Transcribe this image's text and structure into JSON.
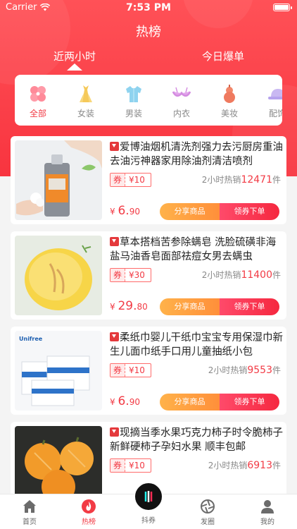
{
  "status": {
    "carrier": "Carrier",
    "time": "7:53 PM"
  },
  "header": {
    "title": "热榜"
  },
  "tabs": [
    {
      "label": "近两小时",
      "active": true
    },
    {
      "label": "今日爆单",
      "active": false
    }
  ],
  "categories": [
    {
      "label": "全部",
      "icon": "all-icon",
      "active": true
    },
    {
      "label": "女装",
      "icon": "dress-icon",
      "active": false
    },
    {
      "label": "男装",
      "icon": "shirt-icon",
      "active": false
    },
    {
      "label": "内衣",
      "icon": "bra-icon",
      "active": false
    },
    {
      "label": "美妆",
      "icon": "gourd-icon",
      "active": false
    },
    {
      "label": "配饰",
      "icon": "hat-icon",
      "active": false
    }
  ],
  "products": [
    {
      "title": "爱博油烟机清洗剂强力去污厨房重油去油污神器家用除油剂清洁喷剂",
      "coupon_tag": "券",
      "coupon_value": "¥10",
      "sold_prefix": "2小时热销",
      "sold_count": "12471",
      "sold_unit": "件",
      "price_symbol": "¥",
      "price_int": "6.",
      "price_dec": "90",
      "share_label": "分享商品",
      "get_label": "领券下单"
    },
    {
      "title": "草本搭档苦参除螨皂 洗脸硫磺非海盐马油香皂面部祛痘女男去螨虫",
      "coupon_tag": "券",
      "coupon_value": "¥30",
      "sold_prefix": "2小时热销",
      "sold_count": "11400",
      "sold_unit": "件",
      "price_symbol": "¥",
      "price_int": "29.",
      "price_dec": "80",
      "share_label": "分享商品",
      "get_label": "领券下单"
    },
    {
      "title": "柔纸巾婴儿干纸巾宝宝专用保湿巾新生儿面巾纸手口用儿童抽纸小包",
      "coupon_tag": "券",
      "coupon_value": "¥10",
      "sold_prefix": "2小时热销",
      "sold_count": "9553",
      "sold_unit": "件",
      "price_symbol": "¥",
      "price_int": "6.",
      "price_dec": "90",
      "share_label": "分享商品",
      "get_label": "领券下单",
      "brand_text": "Unifree"
    },
    {
      "title": "现摘当季水果巧克力柿子时令脆柿子新鲜硬柿子孕妇水果 顺丰包邮",
      "coupon_tag": "券",
      "coupon_value": "¥10",
      "sold_prefix": "2小时热销",
      "sold_count": "6913",
      "sold_unit": "件"
    }
  ],
  "tabbar": [
    {
      "label": "首页",
      "icon": "home-icon",
      "active": false
    },
    {
      "label": "热榜",
      "icon": "flame-icon",
      "active": true
    },
    {
      "label": "抖券",
      "icon": "douyin-icon",
      "active": false
    },
    {
      "label": "发圈",
      "icon": "aperture-icon",
      "active": false
    },
    {
      "label": "我的",
      "icon": "user-icon",
      "active": false
    }
  ],
  "colors": {
    "brand_red": "#f23b45",
    "share_orange": "#ff9f40",
    "get_red": "#f5283f"
  }
}
